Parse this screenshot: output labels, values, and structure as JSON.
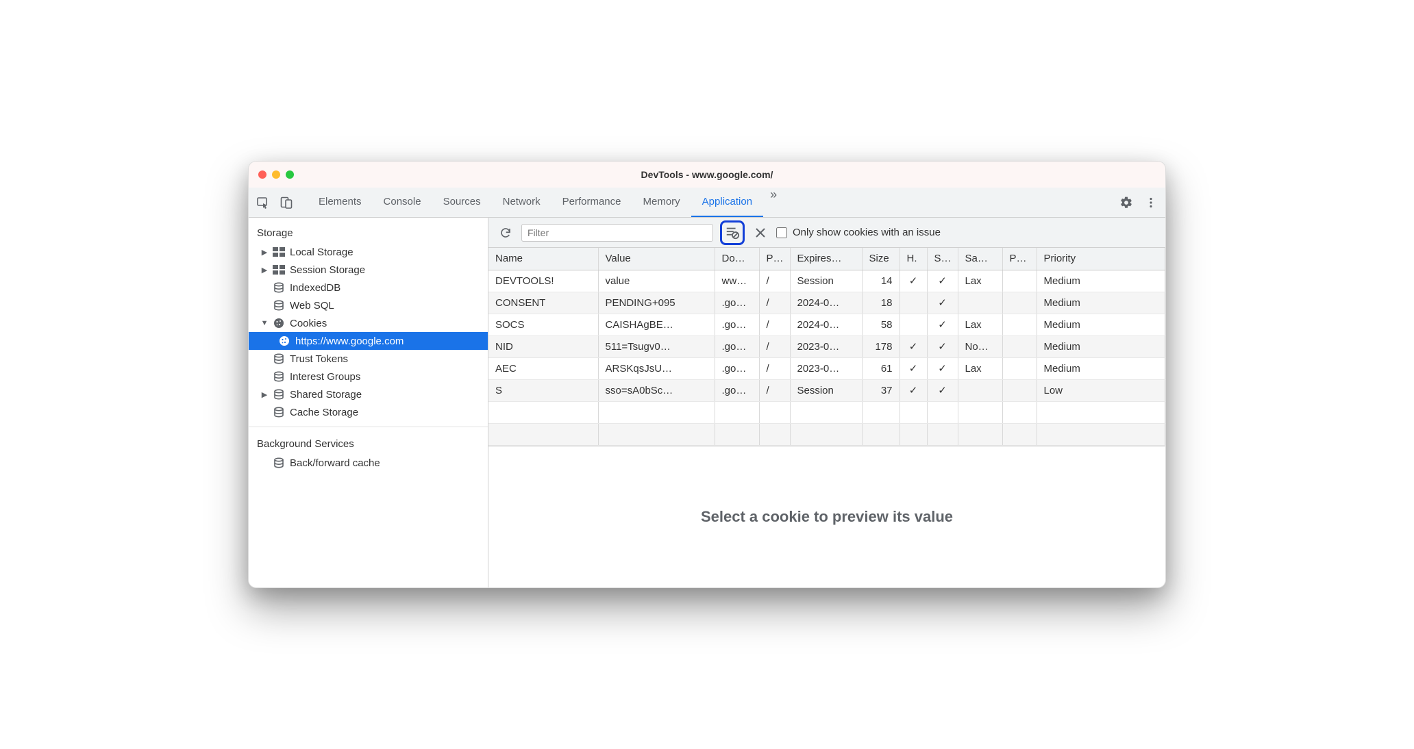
{
  "window": {
    "title": "DevTools - www.google.com/"
  },
  "tabs": {
    "items": [
      "Elements",
      "Console",
      "Sources",
      "Network",
      "Performance",
      "Memory",
      "Application"
    ],
    "active": "Application",
    "more": "»"
  },
  "sidebar": {
    "section_storage": "Storage",
    "section_bg": "Background Services",
    "items": {
      "local_storage": "Local Storage",
      "session_storage": "Session Storage",
      "indexeddb": "IndexedDB",
      "websql": "Web SQL",
      "cookies": "Cookies",
      "cookies_origin": "https://www.google.com",
      "trust_tokens": "Trust Tokens",
      "interest_groups": "Interest Groups",
      "shared_storage": "Shared Storage",
      "cache_storage": "Cache Storage",
      "bfcache": "Back/forward cache"
    }
  },
  "toolbar": {
    "filter_placeholder": "Filter",
    "only_issues_label": "Only show cookies with an issue"
  },
  "table": {
    "columns": [
      "Name",
      "Value",
      "Do…",
      "P…",
      "Expires…",
      "Size",
      "H.",
      "S…",
      "Sa…",
      "P…",
      "Priority"
    ],
    "rows": [
      {
        "name": "DEVTOOLS!",
        "value": "value",
        "domain": "ww…",
        "path": "/",
        "expires": "Session",
        "size": "14",
        "http": "✓",
        "secure": "✓",
        "samesite": "Lax",
        "partition": "",
        "priority": "Medium"
      },
      {
        "name": "CONSENT",
        "value": "PENDING+095",
        "domain": ".go…",
        "path": "/",
        "expires": "2024-0…",
        "size": "18",
        "http": "",
        "secure": "✓",
        "samesite": "",
        "partition": "",
        "priority": "Medium"
      },
      {
        "name": "SOCS",
        "value": "CAISHAgBE…",
        "domain": ".go…",
        "path": "/",
        "expires": "2024-0…",
        "size": "58",
        "http": "",
        "secure": "✓",
        "samesite": "Lax",
        "partition": "",
        "priority": "Medium"
      },
      {
        "name": "NID",
        "value": "511=Tsugv0…",
        "domain": ".go…",
        "path": "/",
        "expires": "2023-0…",
        "size": "178",
        "http": "✓",
        "secure": "✓",
        "samesite": "No…",
        "partition": "",
        "priority": "Medium"
      },
      {
        "name": "AEC",
        "value": "ARSKqsJsU…",
        "domain": ".go…",
        "path": "/",
        "expires": "2023-0…",
        "size": "61",
        "http": "✓",
        "secure": "✓",
        "samesite": "Lax",
        "partition": "",
        "priority": "Medium"
      },
      {
        "name": "S",
        "value": "sso=sA0bSc…",
        "domain": ".go…",
        "path": "/",
        "expires": "Session",
        "size": "37",
        "http": "✓",
        "secure": "✓",
        "samesite": "",
        "partition": "",
        "priority": "Low"
      }
    ]
  },
  "preview": {
    "empty_message": "Select a cookie to preview its value"
  }
}
